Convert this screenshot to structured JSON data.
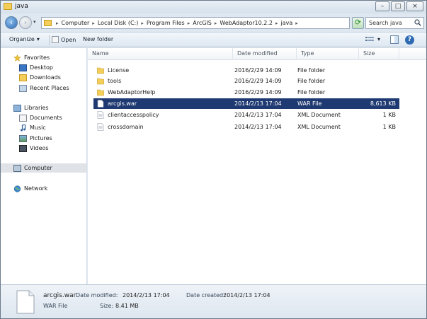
{
  "window": {
    "title": "java",
    "controls": {
      "minimize": "–",
      "maximize": "□",
      "close": "×"
    }
  },
  "address": {
    "breadcrumbs": [
      "Computer",
      "Local Disk (C:)",
      "Program Files",
      "ArcGIS",
      "WebAdaptor10.2.2",
      "java"
    ],
    "separator": "▸",
    "dropdown": "▾"
  },
  "search": {
    "placeholder": "Search java"
  },
  "toolbar": {
    "organize": "Organize",
    "organize_arrow": "▾",
    "open": "Open",
    "new_folder": "New folder",
    "view_arrow": "▾",
    "help": "?"
  },
  "navigation": {
    "favorites": {
      "label": "Favorites",
      "items": [
        "Desktop",
        "Downloads",
        "Recent Places"
      ]
    },
    "libraries": {
      "label": "Libraries",
      "items": [
        "Documents",
        "Music",
        "Pictures",
        "Videos"
      ]
    },
    "computer": "Computer",
    "network": "Network"
  },
  "columns": {
    "name": "Name",
    "date": "Date modified",
    "type": "Type",
    "size": "Size"
  },
  "files": [
    {
      "name": "License",
      "date": "2016/2/29 14:09",
      "type": "File folder",
      "size": "",
      "icon": "folder"
    },
    {
      "name": "tools",
      "date": "2016/2/29 14:09",
      "type": "File folder",
      "size": "",
      "icon": "folder"
    },
    {
      "name": "WebAdaptorHelp",
      "date": "2016/2/29 14:09",
      "type": "File folder",
      "size": "",
      "icon": "folder"
    },
    {
      "name": "arcgis.war",
      "date": "2014/2/13 17:04",
      "type": "WAR File",
      "size": "8,613 KB",
      "icon": "file",
      "selected": true
    },
    {
      "name": "clientaccesspolicy",
      "date": "2014/2/13 17:04",
      "type": "XML Document",
      "size": "1 KB",
      "icon": "xml"
    },
    {
      "name": "crossdomain",
      "date": "2014/2/13 17:04",
      "type": "XML Document",
      "size": "1 KB",
      "icon": "xml"
    }
  ],
  "details": {
    "file_name": "arcgis.war",
    "modified_label": "Date modified:",
    "modified_value": "2014/2/13 17:04",
    "created_label": "Date created:",
    "created_value": "2014/2/13 17:04",
    "type": "WAR File",
    "size_label": "Size:",
    "size_value": "8.41 MB"
  },
  "colors": {
    "selection": "#1f3a72",
    "folder": "#f3cf5a",
    "window_chrome": "#dfe8f1"
  }
}
